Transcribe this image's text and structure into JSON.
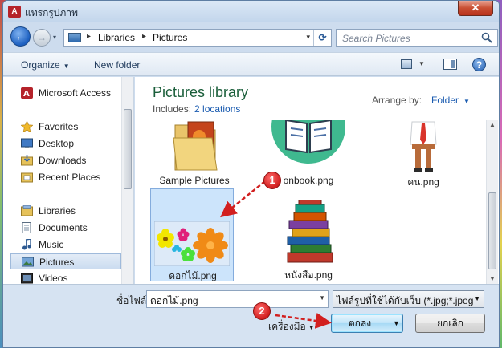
{
  "window": {
    "title": "แทรกรูปภาพ",
    "app_icon_label": "A",
    "close_label": "✕"
  },
  "nav": {
    "back_glyph": "←",
    "forward_glyph": "→",
    "breadcrumb": [
      "Libraries",
      "Pictures"
    ],
    "crumb_separator": "▸",
    "dropdown_glyph": "▾",
    "refresh_glyph": "⟳"
  },
  "search": {
    "placeholder": "Search Pictures"
  },
  "toolbar": {
    "organize_label": "Organize",
    "new_folder_label": "New folder",
    "help_label": "?"
  },
  "sidebar": {
    "items": [
      {
        "label": "Microsoft Access",
        "icon": "access-icon"
      },
      {
        "label": "Favorites",
        "icon": "star-icon"
      },
      {
        "label": "Desktop",
        "icon": "desktop-icon"
      },
      {
        "label": "Downloads",
        "icon": "downloads-icon"
      },
      {
        "label": "Recent Places",
        "icon": "recent-places-icon"
      },
      {
        "label": "Libraries",
        "icon": "libraries-icon"
      },
      {
        "label": "Documents",
        "icon": "documents-icon"
      },
      {
        "label": "Music",
        "icon": "music-icon"
      },
      {
        "label": "Pictures",
        "icon": "pictures-icon",
        "selected": true
      },
      {
        "label": "Videos",
        "icon": "videos-icon"
      }
    ]
  },
  "library": {
    "title": "Pictures library",
    "includes_label": "Includes:",
    "includes_link": "2 locations",
    "arrange_label": "Arrange by:",
    "arrange_value": "Folder"
  },
  "files": [
    {
      "name": "Sample Pictures",
      "type": "folder"
    },
    {
      "name": "onbook.png",
      "type": "image"
    },
    {
      "name": "คน.png",
      "type": "image"
    },
    {
      "name": "ดอกไม้.png",
      "type": "image",
      "selected": true
    },
    {
      "name": "หนังสือ.png",
      "type": "image"
    }
  ],
  "bottom": {
    "filename_label": "ชื่อไฟล์:",
    "filename_value": "ดอกไม้.png",
    "filetype_value": "ไฟล์รูปที่ใช้ได้กับเว็บ (*.jpg;*.jpeg",
    "tools_label": "เครื่องมือ",
    "ok_label": "ตกลง",
    "cancel_label": "ยกเลิก"
  },
  "annotations": {
    "step1_label": "1",
    "step2_label": "2",
    "color": "#d21f1f"
  },
  "colors": {
    "library_title": "#1a5e3a",
    "link": "#1a5bb0",
    "selection": "#cce4fb"
  }
}
